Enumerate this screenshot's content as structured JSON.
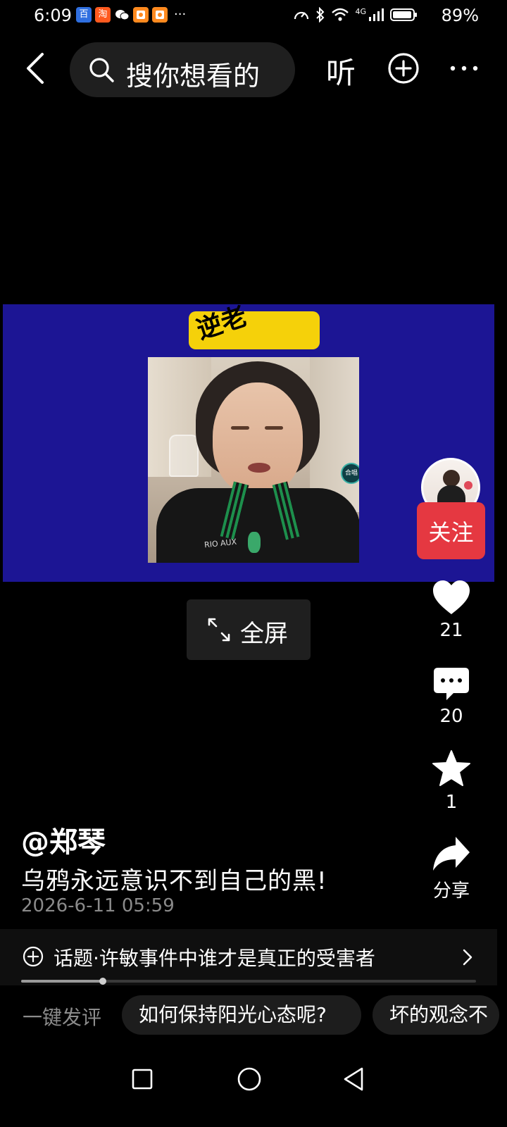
{
  "status_bar": {
    "time": "6:09",
    "network": "4G",
    "battery": "89%",
    "app_icons": [
      {
        "name": "baidu-icon",
        "glyph": "百",
        "color": "#2f6fe0"
      },
      {
        "name": "taobao-icon",
        "glyph": "淘",
        "color": "#ff5a1f"
      },
      {
        "name": "wechat-icon",
        "glyph": "",
        "color": "#000000"
      },
      {
        "name": "app-orange-icon-1",
        "glyph": "",
        "color": "#ff8a1f"
      },
      {
        "name": "app-orange-icon-2",
        "glyph": "",
        "color": "#ff8a1f"
      }
    ],
    "more": "···"
  },
  "top_bar": {
    "search_placeholder": "搜你想看的",
    "listen_label": "听"
  },
  "video": {
    "banner_text": "逆老",
    "frame_logo": "RIO AUX",
    "frame_badge": "合唱"
  },
  "right_rail": {
    "follow_label": "关注",
    "likes": "21",
    "comments": "20",
    "favorites": "1",
    "share_label": "分享"
  },
  "fullscreen_label": "全屏",
  "post": {
    "author": "@郑琴",
    "caption": "乌鸦永远意识不到自己的黑!",
    "timestamp": "2026-6-11 05:59"
  },
  "topic": {
    "text": "话题·许敏事件中谁才是真正的受害者"
  },
  "progress": {
    "fraction": 0.18
  },
  "quick_comments": {
    "label": "一键发评",
    "chips": [
      "如何保持阳光心态呢?",
      "坏的观念不"
    ]
  },
  "colors": {
    "background": "#000000",
    "video_bg": "#1c1594",
    "banner": "#f5d10a",
    "follow": "#e53841"
  }
}
